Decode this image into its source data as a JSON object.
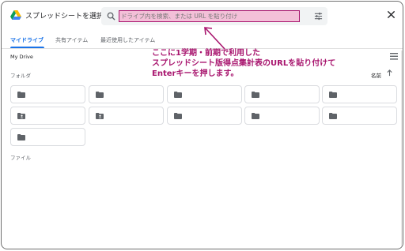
{
  "header": {
    "title": "スプレッドシートを選択",
    "search_placeholder": "ドライブ内を検索、または URL を貼り付け",
    "icons": [
      "drive-logo",
      "search-icon",
      "tune-icon",
      "close-icon"
    ]
  },
  "tabs": [
    {
      "label": "マイドライブ",
      "active": true
    },
    {
      "label": "共有アイテム",
      "active": false
    },
    {
      "label": "最近使用したアイテム",
      "active": false
    }
  ],
  "breadcrumb": "My Drive",
  "sections": {
    "folders_label": "フォルダ",
    "files_label": "ファイル",
    "sort_label": "名前"
  },
  "folders": [
    {
      "icon": "folder-icon"
    },
    {
      "icon": "folder-icon"
    },
    {
      "icon": "folder-icon"
    },
    {
      "icon": "folder-icon"
    },
    {
      "icon": "folder-icon"
    },
    {
      "icon": "shared-folder-icon"
    },
    {
      "icon": "shared-folder-icon"
    },
    {
      "icon": "folder-icon"
    },
    {
      "icon": "folder-icon"
    },
    {
      "icon": "folder-icon"
    },
    {
      "icon": "folder-icon"
    }
  ],
  "annotation": {
    "line1": "ここに1学期・前期で利用した",
    "line2": "スプレッドシート版得点集計表のURLを貼り付けて",
    "line3": "Enterキーを押します。"
  },
  "colors": {
    "accent": "#1a73e8",
    "annotation": "#a8156e",
    "search_highlight": "#f3c0d8"
  }
}
